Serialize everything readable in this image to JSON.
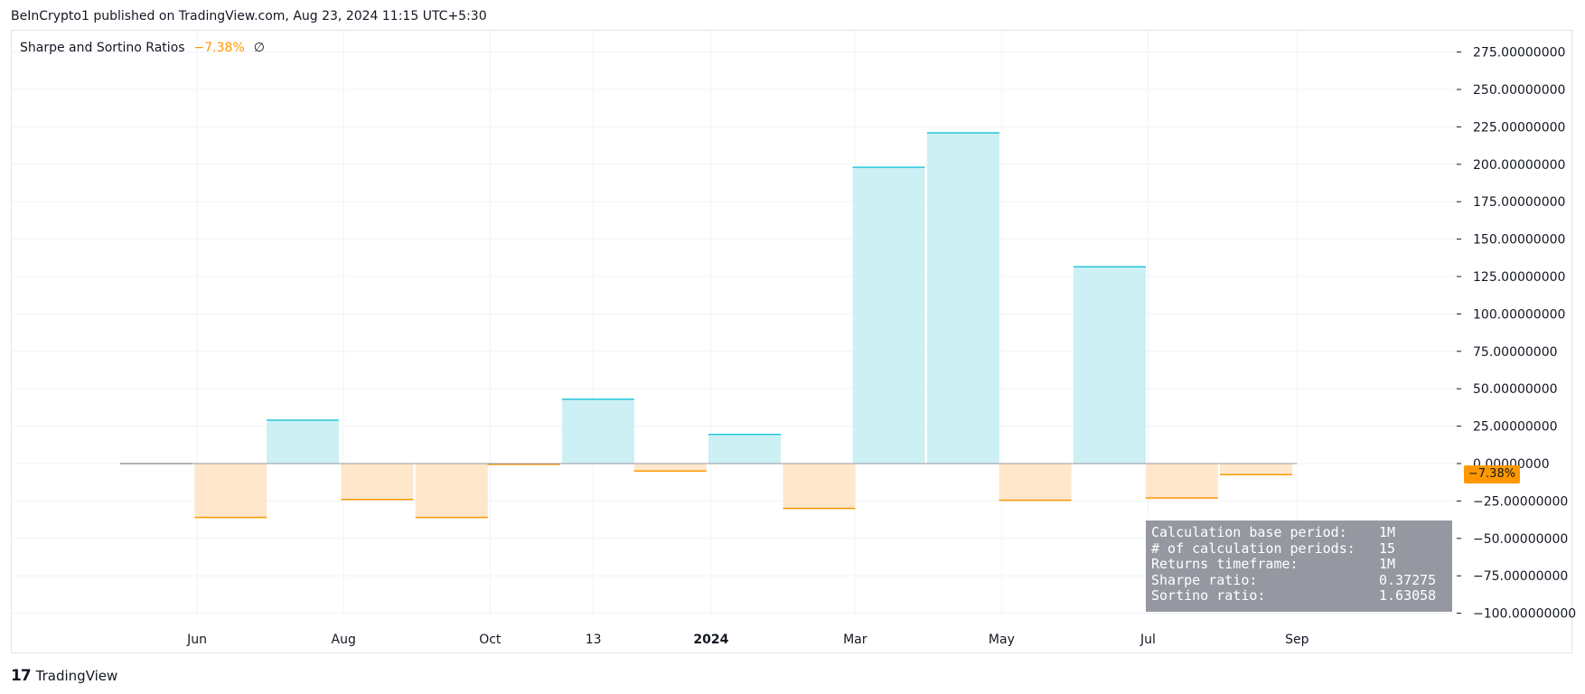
{
  "header": {
    "text": "BeInCrypto1 published on TradingView.com, Aug 23, 2024 11:15 UTC+5:30"
  },
  "legend": {
    "title": "Sharpe and Sortino Ratios",
    "value": "−7.38%",
    "extra": "∅"
  },
  "price_tag": "−7.38%",
  "footer": {
    "logo_glyph": "17",
    "brand": "TradingView"
  },
  "info_box": {
    "rows": [
      {
        "label": "Calculation base period:",
        "value": "1M"
      },
      {
        "label": "# of calculation periods:",
        "value": "15"
      },
      {
        "label": "Returns timeframe:",
        "value": "1M"
      },
      {
        "label": "Sharpe ratio:",
        "value": "0.37275"
      },
      {
        "label": "Sortino ratio:",
        "value": "1.63058"
      }
    ]
  },
  "colors": {
    "positive_fill": "#ccf0f4",
    "positive_line": "#26c6da",
    "negative_fill": "#ffe7cc",
    "negative_line": "#ff9800",
    "grid": "#f0f3fa",
    "zero_line": "#9598a1"
  },
  "chart_data": {
    "type": "bar",
    "title": "Sharpe and Sortino Ratios",
    "y_unit": "%",
    "ylim": [
      -100,
      275
    ],
    "y_ticks": [
      275,
      250,
      225,
      200,
      175,
      150,
      125,
      100,
      75,
      50,
      25,
      0,
      -25,
      -50,
      -75,
      -100
    ],
    "y_tick_labels": [
      "275.00000000",
      "250.00000000",
      "225.00000000",
      "200.00000000",
      "175.00000000",
      "150.00000000",
      "125.00000000",
      "100.00000000",
      "75.00000000",
      "50.00000000",
      "25.00000000",
      "0.00000000",
      "−25.00000000",
      "−50.00000000",
      "−75.00000000",
      "−100.00000000"
    ],
    "x_tick_labels": [
      {
        "label": "Jun",
        "date": "2023-06-01",
        "bold": false
      },
      {
        "label": "Aug",
        "date": "2023-08-01",
        "bold": false
      },
      {
        "label": "Oct",
        "date": "2023-10-01",
        "bold": false
      },
      {
        "label": "13",
        "date": "2023-11-13",
        "bold": false
      },
      {
        "label": "2024",
        "date": "2024-01-01",
        "bold": true
      },
      {
        "label": "Mar",
        "date": "2024-03-01",
        "bold": false
      },
      {
        "label": "May",
        "date": "2024-05-01",
        "bold": false
      },
      {
        "label": "Jul",
        "date": "2024-07-01",
        "bold": false
      },
      {
        "label": "Sep",
        "date": "2024-09-01",
        "bold": false
      }
    ],
    "x_start": "2023-04-01",
    "x_end": "2024-10-01",
    "bars": [
      {
        "month": "2023-05",
        "value": 0
      },
      {
        "month": "2023-06",
        "value": -36
      },
      {
        "month": "2023-07",
        "value": 29
      },
      {
        "month": "2023-08",
        "value": -24
      },
      {
        "month": "2023-09",
        "value": -36
      },
      {
        "month": "2023-10",
        "value": -0.5
      },
      {
        "month": "2023-11",
        "value": 43
      },
      {
        "month": "2023-12",
        "value": -5
      },
      {
        "month": "2024-01",
        "value": 19.5
      },
      {
        "month": "2024-02",
        "value": -30
      },
      {
        "month": "2024-03",
        "value": 198
      },
      {
        "month": "2024-04",
        "value": 221
      },
      {
        "month": "2024-05",
        "value": -24.5
      },
      {
        "month": "2024-06",
        "value": 131.5
      },
      {
        "month": "2024-07",
        "value": -23
      },
      {
        "month": "2024-08",
        "value": -7.38
      }
    ],
    "current_value": -7.38
  }
}
